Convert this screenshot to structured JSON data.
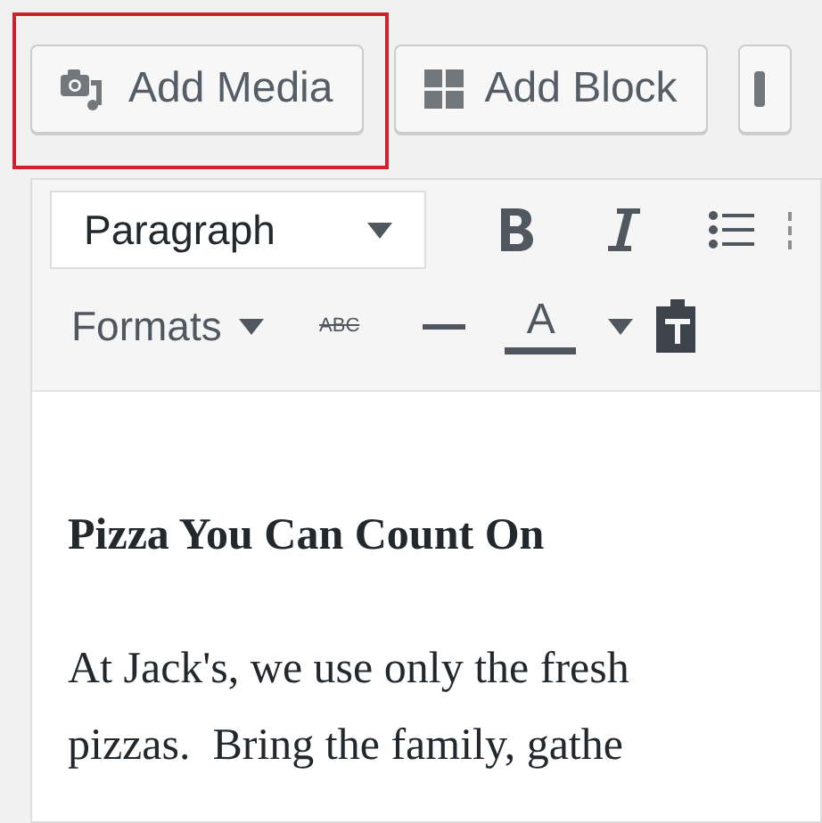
{
  "media_buttons": [
    {
      "kind": "media",
      "label": "Add Media",
      "highlighted": true
    },
    {
      "kind": "block",
      "label": "Add Block",
      "highlighted": false
    },
    {
      "kind": "partial",
      "highlighted": false
    }
  ],
  "toolbar_rows": [
    [
      {
        "kind": "select",
        "label": "Paragraph"
      },
      {
        "kind": "bold"
      },
      {
        "kind": "italic"
      },
      {
        "kind": "bullet-list"
      },
      {
        "kind": "numbered-list"
      }
    ],
    [
      {
        "kind": "dropdown",
        "label": "Formats"
      },
      {
        "kind": "strike",
        "label": "ABC"
      },
      {
        "kind": "rule"
      },
      {
        "kind": "text-color",
        "label": "A"
      },
      {
        "kind": "caret"
      },
      {
        "kind": "paste-text"
      }
    ]
  ],
  "content": {
    "heading": "Pizza You Can Count On",
    "lines": [
      "At Jack's, we use only the fresh",
      "pizzas.  Bring the family, gathe"
    ]
  }
}
